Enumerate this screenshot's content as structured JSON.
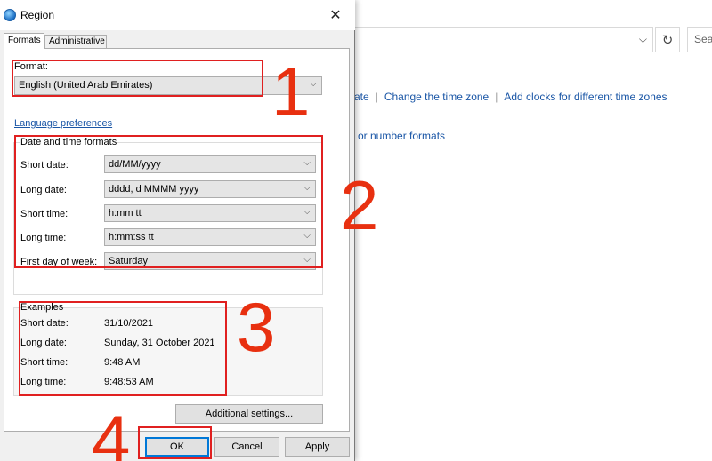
{
  "background": {
    "address_chevron": "⌵",
    "refresh_glyph": "↻",
    "search_placeholder": "Sea",
    "links": [
      "ate",
      "Change the time zone",
      "Add clocks for different time zones"
    ],
    "link_number": "or number formats"
  },
  "dialog": {
    "title": "Region",
    "close_glyph": "✕",
    "tabs": [
      "Formats",
      "Administrative"
    ],
    "format": {
      "label": "Format:",
      "value": "English (United Arab Emirates)"
    },
    "language_link": "Language preferences",
    "date_time_group": {
      "title": "Date and time formats",
      "rows": [
        {
          "label": "Short date:",
          "value": "dd/MM/yyyy"
        },
        {
          "label": "Long date:",
          "value": "dddd, d MMMM yyyy"
        },
        {
          "label": "Short time:",
          "value": "h:mm tt"
        },
        {
          "label": "Long time:",
          "value": "h:mm:ss tt"
        },
        {
          "label": "First day of week:",
          "value": "Saturday"
        }
      ]
    },
    "examples": {
      "title": "Examples",
      "rows": [
        {
          "label": "Short date:",
          "value": "31/10/2021"
        },
        {
          "label": "Long date:",
          "value": "Sunday, 31 October 2021"
        },
        {
          "label": "Short time:",
          "value": "9:48 AM"
        },
        {
          "label": "Long time:",
          "value": "9:48:53 AM"
        }
      ]
    },
    "buttons": {
      "additional": "Additional settings...",
      "ok": "OK",
      "cancel": "Cancel",
      "apply": "Apply"
    }
  },
  "annotations": [
    "1",
    "2",
    "3",
    "4"
  ],
  "colors": {
    "annotation": "#e02020",
    "link": "#1a56a6",
    "focus": "#0078d7"
  }
}
